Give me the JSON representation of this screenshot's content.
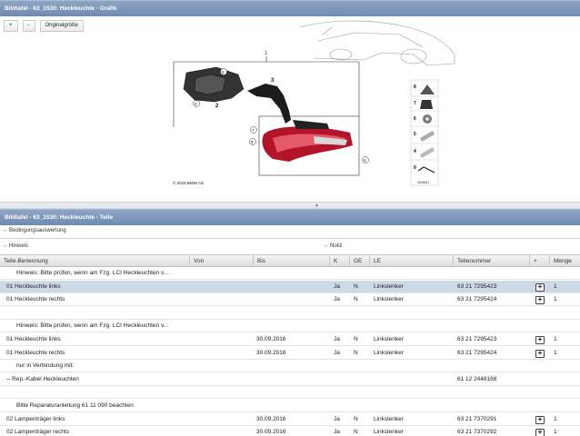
{
  "graphic_panel": {
    "title": "Bildtafel - 63_1530: Heckleuchte - Grafik",
    "toolbar": {
      "zoom_in": "+",
      "zoom_out": "-",
      "original_size": "Originalgröße"
    },
    "diagram": {
      "copyright": "© 2015 BMW AG",
      "image_number": "465651",
      "callouts": [
        "1",
        "2",
        "3",
        "4",
        "5",
        "6",
        "7",
        "8",
        "9"
      ],
      "side_panel_numbers": [
        "8",
        "7",
        "6",
        "5",
        "4",
        "9"
      ]
    }
  },
  "parts_panel": {
    "title": "Bildtafel - 63_1530: Heckleuchte - Teile",
    "bedingungsauswertung": "Bedingungsauswertung",
    "hinweis": "Hinweis",
    "notiz": "Notiz",
    "columns": [
      "Teile-Benennung",
      "Von",
      "Bis",
      "K",
      "GE",
      "LE",
      "Teilenummer",
      "+",
      "Menge"
    ],
    "rows": [
      {
        "type": "note",
        "text": "Hinweis: Bitte prüfen, wenn am Fzg. LCI Heckleuchten v..."
      },
      {
        "type": "part",
        "selected": true,
        "name": "01 Heckleuchte links",
        "von": "",
        "bis": "",
        "k": "Ja",
        "ge": "N",
        "le": "Linkslenker",
        "teilenummer": "63 21 7295423",
        "menge": "1"
      },
      {
        "type": "part",
        "name": "01 Heckleuchte rechts",
        "von": "",
        "bis": "",
        "k": "Ja",
        "ge": "N",
        "le": "Linkslenker",
        "teilenummer": "63 21 7295424",
        "menge": "1"
      },
      {
        "type": "empty"
      },
      {
        "type": "note",
        "text": "Hinweis: Bitte prüfen, wenn am Fzg. LCI Heckleuchten v..."
      },
      {
        "type": "part",
        "name": "01 Heckleuchte links",
        "von": "",
        "bis": "30.09.2016",
        "k": "Ja",
        "ge": "N",
        "le": "Linkslenker",
        "teilenummer": "63 21 7295423",
        "menge": "1"
      },
      {
        "type": "part",
        "name": "01 Heckleuchte rechts",
        "von": "",
        "bis": "30.09.2016",
        "k": "Ja",
        "ge": "N",
        "le": "Linkslenker",
        "teilenummer": "63 21 7295424",
        "menge": "1"
      },
      {
        "type": "note",
        "text": "nur in Verbindung mit:"
      },
      {
        "type": "part",
        "name": "-- Rep.-Kabel Heckleuchten",
        "von": "",
        "bis": "",
        "k": "",
        "ge": "",
        "le": "",
        "teilenummer": "61 12 2448168",
        "menge": "",
        "no_button": true
      },
      {
        "type": "empty"
      },
      {
        "type": "note",
        "text": "Bitte Reparaturanleitung 61 11 090 beachten"
      },
      {
        "type": "part",
        "name": "02 Lampenträger links",
        "von": "",
        "bis": "30.09.2016",
        "k": "Ja",
        "ge": "N",
        "le": "Linkslenker",
        "teilenummer": "63 21 7370291",
        "menge": "1"
      },
      {
        "type": "part",
        "name": "02 Lampenträger rechts",
        "von": "",
        "bis": "30.09.2016",
        "k": "Ja",
        "ge": "N",
        "le": "Linkslenker",
        "teilenummer": "63 21 7370292",
        "menge": "1"
      }
    ],
    "plus_label": "+"
  }
}
